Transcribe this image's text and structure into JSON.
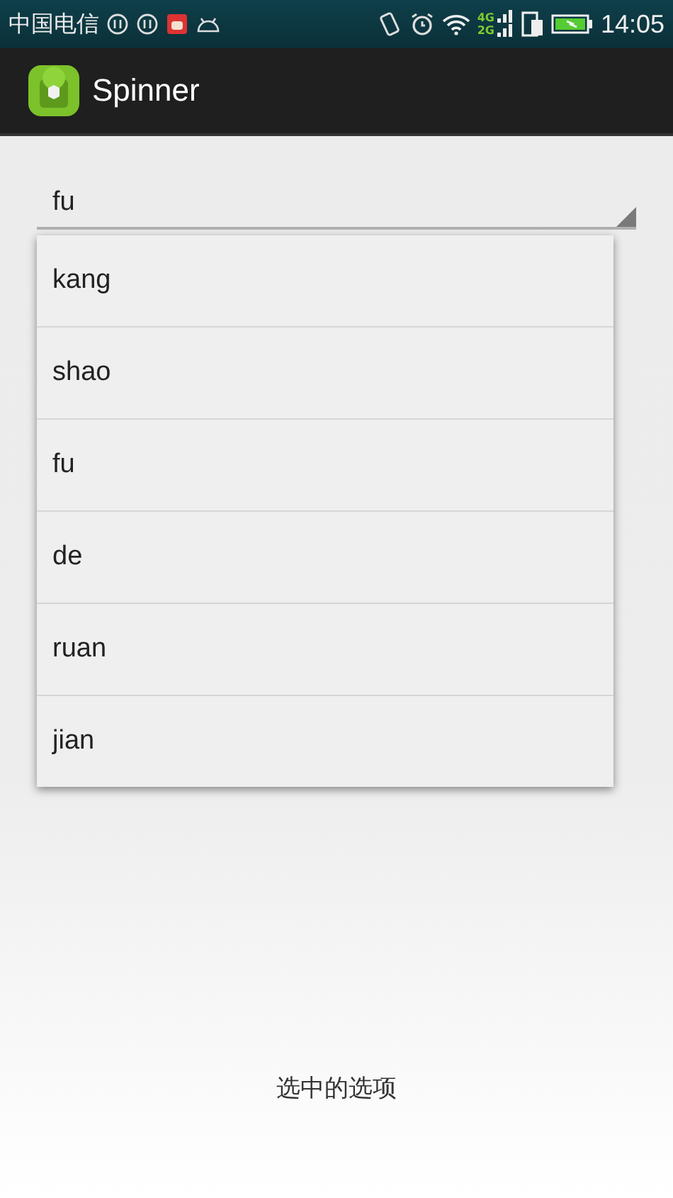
{
  "status_bar": {
    "carrier": "中国电信",
    "network_top": "4G",
    "network_bottom": "2G",
    "time": "14:05"
  },
  "app_bar": {
    "title": "Spinner"
  },
  "spinner": {
    "value": "fu",
    "expanded": true
  },
  "dropdown": {
    "items": [
      {
        "label": "kang"
      },
      {
        "label": "shao"
      },
      {
        "label": "fu"
      },
      {
        "label": "de"
      },
      {
        "label": "ruan"
      },
      {
        "label": "jian"
      }
    ]
  },
  "result_text": "选中的选项"
}
